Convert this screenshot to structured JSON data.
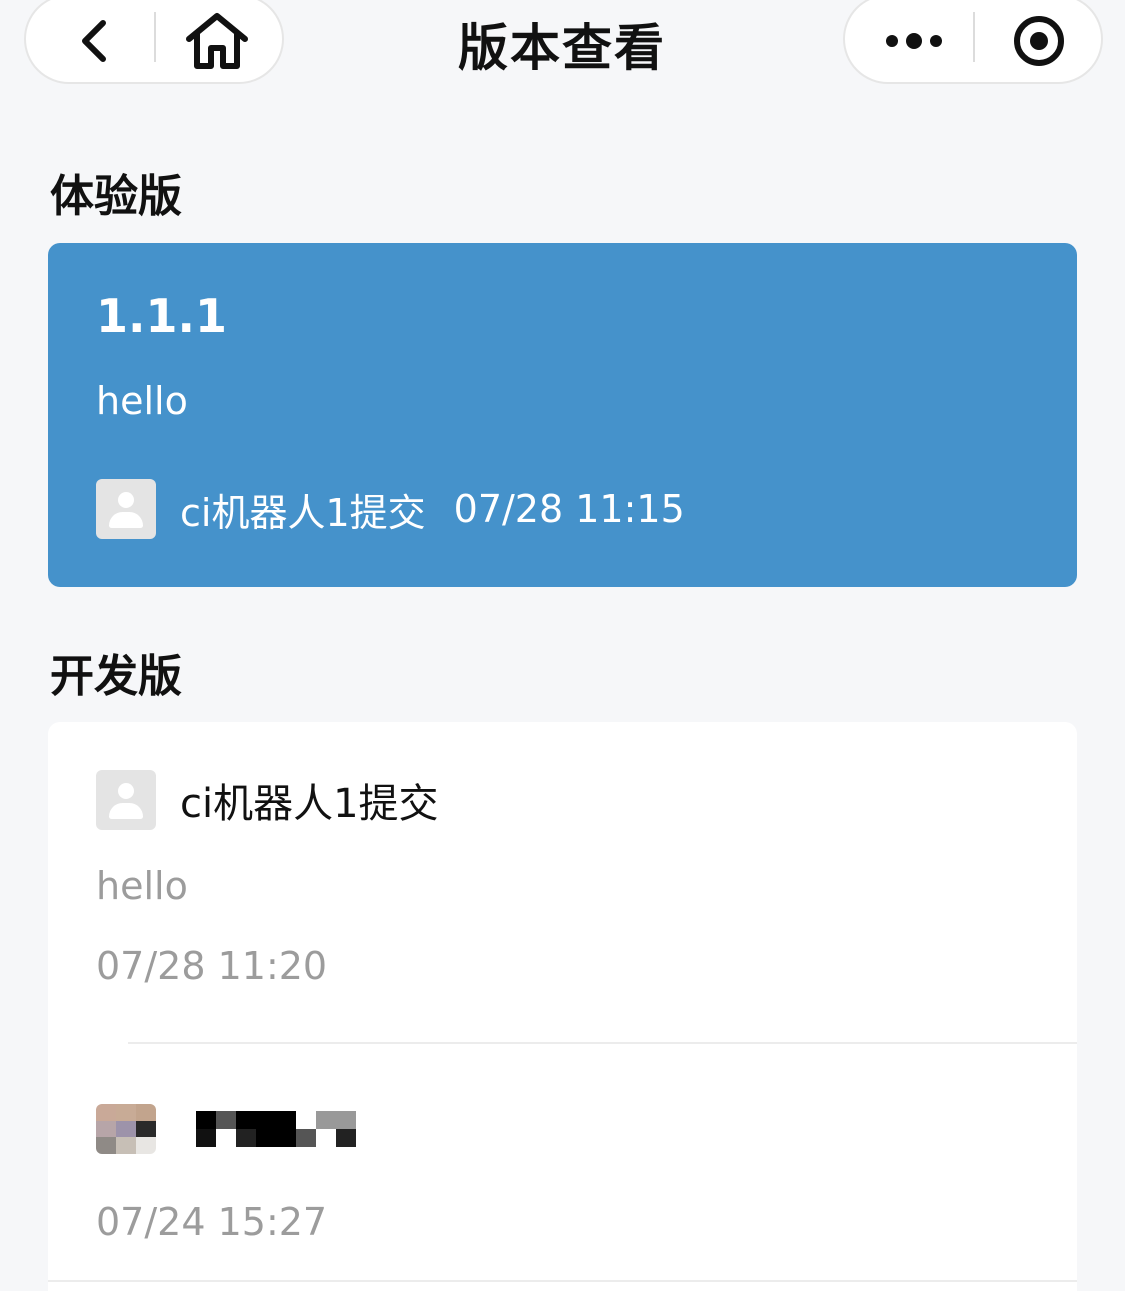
{
  "nav": {
    "title": "版本查看",
    "back_icon": "chevron-left-icon",
    "home_icon": "home-icon",
    "more_icon": "more-dots-icon",
    "close_icon": "target-circle-icon"
  },
  "experience": {
    "section_title": "体验版",
    "version": "1.1.1",
    "description": "hello",
    "submitter": "ci机器人1提交",
    "time": "07/28 11:15",
    "card_color": "#4592cb"
  },
  "development": {
    "section_title": "开发版",
    "items": [
      {
        "submitter": "ci机器人1提交",
        "description": "hello",
        "time": "07/28 11:20"
      },
      {
        "submitter": "",
        "time": "07/24 15:27"
      }
    ]
  }
}
